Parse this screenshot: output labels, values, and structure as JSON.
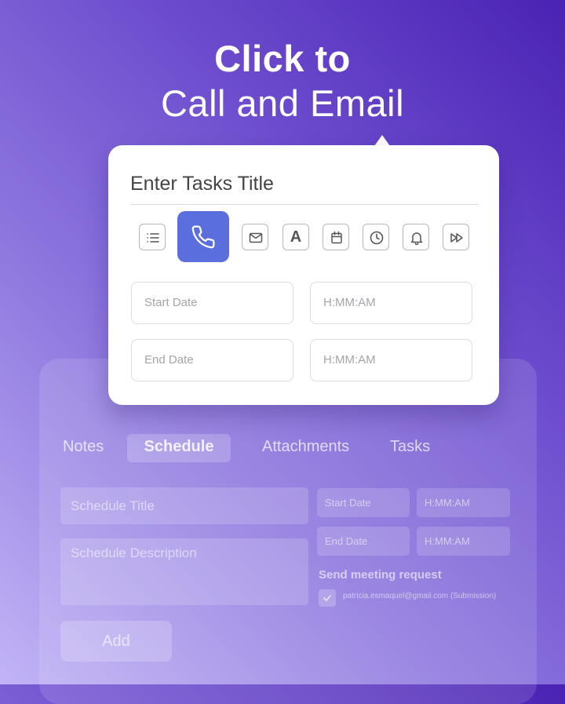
{
  "headline": {
    "line1": "Click to",
    "line2": "Call and Email"
  },
  "popover": {
    "title_placeholder": "Enter Tasks Title",
    "toolbar": [
      {
        "icon": "list-icon"
      },
      {
        "icon": "phone-icon",
        "active": true
      },
      {
        "icon": "mail-icon"
      },
      {
        "icon": "text-format-icon",
        "glyph": "A"
      },
      {
        "icon": "calendar-icon"
      },
      {
        "icon": "clock-icon"
      },
      {
        "icon": "bell-icon"
      },
      {
        "icon": "fast-forward-icon"
      }
    ],
    "start_date_placeholder": "Start Date",
    "start_time_placeholder": "H:MM:AM",
    "end_date_placeholder": "End Date",
    "end_time_placeholder": "H:MM:AM"
  },
  "background_panel": {
    "tabs": [
      "Notes",
      "Schedule",
      "Attachments",
      "Tasks"
    ],
    "active_tab": "Schedule",
    "schedule_title_placeholder": "Schedule Title",
    "schedule_description_placeholder": "Schedule Description",
    "start_date_placeholder": "Start Date",
    "start_time_placeholder": "H:MM:AM",
    "end_date_placeholder": "End Date",
    "end_time_placeholder": "H:MM:AM",
    "send_meeting_label": "Send meeting request",
    "attendee": "patricia.esmaquel@gmail.com (Submission)",
    "add_label": "Add"
  },
  "colors": {
    "accent": "#5b6ede",
    "gradient_dark": "#4a22b4",
    "gradient_light": "#c2b4f6"
  }
}
